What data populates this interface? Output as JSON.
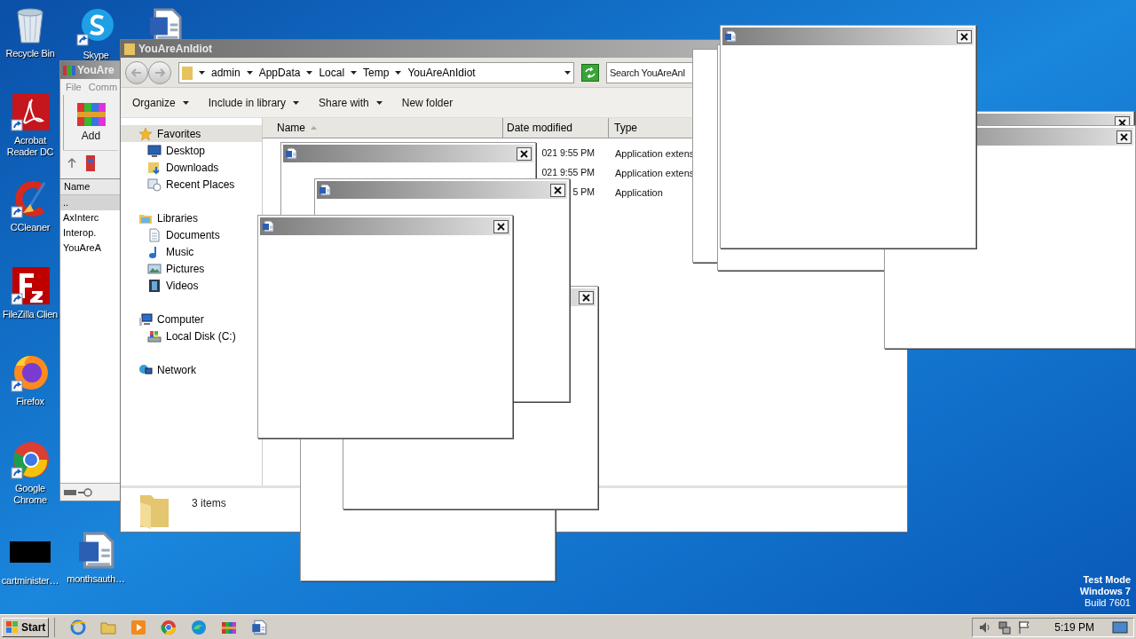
{
  "desktop_icons": [
    {
      "label": "Recycle Bin"
    },
    {
      "label": "Skype"
    },
    {
      "label": "Acrobat Reader DC"
    },
    {
      "label": "CCleaner"
    },
    {
      "label": "FileZilla Clien"
    },
    {
      "label": "Firefox"
    },
    {
      "label": "Google Chrome"
    },
    {
      "label": "cartminister…"
    },
    {
      "label": "monthsauth…"
    }
  ],
  "winrar": {
    "title": "YouAre",
    "menu": [
      "File",
      "Comm"
    ],
    "tool": "Add",
    "column": "Name",
    "files": [
      {
        "name": "..",
        "selected": true
      },
      {
        "name": "AxInterc",
        "selected": false
      },
      {
        "name": "Interop.",
        "selected": false
      },
      {
        "name": "YouAreA",
        "selected": false
      }
    ]
  },
  "explorer": {
    "title": "YouAreAnIdiot",
    "path": [
      "admin",
      "AppData",
      "Local",
      "Temp",
      "YouAreAnIdiot"
    ],
    "search": {
      "placeholder": "Search YouAreAnI"
    },
    "commands": [
      {
        "label": "Organize",
        "menu": true
      },
      {
        "label": "Include in library",
        "menu": true
      },
      {
        "label": "Share with",
        "menu": true
      },
      {
        "label": "New folder",
        "menu": false
      }
    ],
    "nav": [
      {
        "label": "Favorites",
        "selected": true,
        "children": [
          {
            "label": "Desktop",
            "selected": false
          },
          {
            "label": "Downloads",
            "selected": false
          },
          {
            "label": "Recent Places",
            "selected": false
          }
        ]
      },
      {
        "label": "Libraries",
        "selected": false,
        "children": [
          {
            "label": "Documents",
            "selected": false
          },
          {
            "label": "Music",
            "selected": false
          },
          {
            "label": "Pictures",
            "selected": false
          },
          {
            "label": "Videos",
            "selected": false
          }
        ]
      },
      {
        "label": "Computer",
        "selected": false,
        "children": [
          {
            "label": "Local Disk (C:)",
            "selected": false
          }
        ]
      },
      {
        "label": "Network",
        "selected": false
      }
    ],
    "columns": [
      {
        "label": "Name",
        "sorted": true
      },
      {
        "label": "Date modified",
        "sorted": false
      },
      {
        "label": "Type",
        "sorted": false
      }
    ],
    "rows": [
      {
        "date": "021 9:55 PM",
        "type": "Application extens"
      },
      {
        "date": "021 9:55 PM",
        "type": "Application extens"
      },
      {
        "date": "5 PM",
        "type": "Application"
      }
    ],
    "status": "3 items"
  },
  "watermark": [
    "Test Mode",
    "Windows 7",
    "Build 7601"
  ],
  "taskbar": {
    "start": "Start",
    "clock": "5:19 PM"
  }
}
